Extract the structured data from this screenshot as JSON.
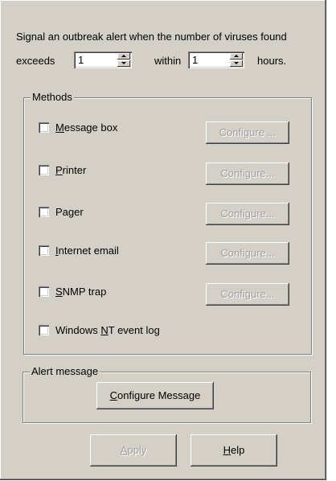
{
  "header": {
    "line1": "Signal an outbreak alert when the number of viruses found",
    "exceeds_label": "exceeds",
    "exceeds_value": "1",
    "within_label": "within",
    "within_value": "1",
    "hours_label": "hours."
  },
  "methods": {
    "title": "Methods",
    "items": [
      {
        "pre": "",
        "u": "M",
        "post": "essage box",
        "button": "Configure ...",
        "checked": false
      },
      {
        "pre": "",
        "u": "P",
        "post": "rinter",
        "button": "Configure...",
        "checked": false
      },
      {
        "pre": "Pa",
        "u": "g",
        "post": "er",
        "button": "Configure...",
        "checked": false
      },
      {
        "pre": "",
        "u": "I",
        "post": "nternet email",
        "button": "Configure...",
        "checked": false
      },
      {
        "pre": "",
        "u": "S",
        "post": "NMP trap",
        "button": "Configure...",
        "checked": false
      },
      {
        "pre": "Windows ",
        "u": "N",
        "post": "T event log",
        "button": "",
        "checked": false
      }
    ]
  },
  "alert": {
    "title": "Alert message",
    "button_u": "C",
    "button_rest": "onfigure Message"
  },
  "footer": {
    "apply_u": "A",
    "apply_rest": "pply",
    "help_u": "H",
    "help_rest": "elp"
  }
}
